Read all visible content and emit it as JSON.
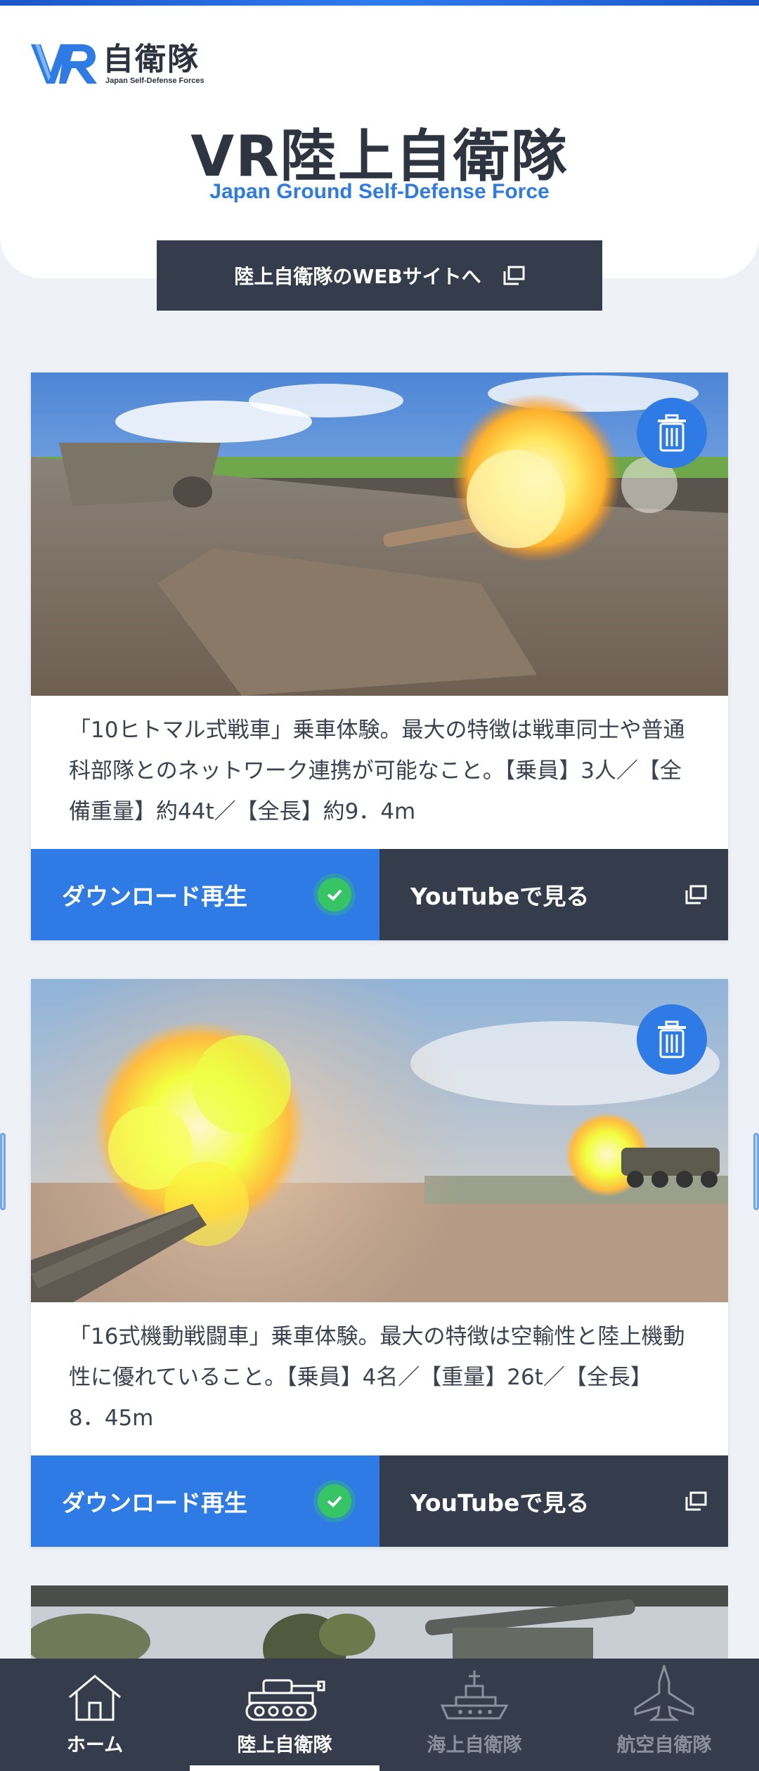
{
  "brand": {
    "logo_text": "自衛隊",
    "logo_subtext": "Japan Self-Defense Forces",
    "accent": "#2f7be6",
    "dark": "#353d4c"
  },
  "header": {
    "title": "VR陸上自衛隊",
    "subtitle": "Japan Ground Self-Defense Force",
    "web_button_label": "陸上自衛隊のWEBサイトへ",
    "web_button_icon": "external-link-icon"
  },
  "cards": [
    {
      "image": "tank-firing-10",
      "description": "「10ヒトマル式戦車」乗車体験。最大の特徴は戦車同士や普通科部隊とのネットワーク連携が可能なこと。【乗員】3人／【全備重量】約44t／【全長】約9．4m",
      "download_label": "ダウンロード再生",
      "download_status_icon": "check-icon",
      "youtube_label": "YouTubeで見る",
      "youtube_icon": "external-link-icon",
      "delete_icon": "trash-icon"
    },
    {
      "image": "combat-vehicle-firing-16",
      "description": "「16式機動戦闘車」乗車体験。最大の特徴は空輸性と陸上機動性に優れていること。【乗員】4名／【重量】26t／【全長】8．45m",
      "download_label": "ダウンロード再生",
      "download_status_icon": "check-icon",
      "youtube_label": "YouTubeで見る",
      "youtube_icon": "external-link-icon",
      "delete_icon": "trash-icon"
    }
  ],
  "bottom_nav": {
    "items": [
      {
        "label": "ホーム",
        "icon": "home-icon",
        "active": false
      },
      {
        "label": "陸上自衛隊",
        "icon": "tank-icon",
        "active": true
      },
      {
        "label": "海上自衛隊",
        "icon": "ship-icon",
        "active": false
      },
      {
        "label": "航空自衛隊",
        "icon": "jet-icon",
        "active": false
      }
    ]
  }
}
